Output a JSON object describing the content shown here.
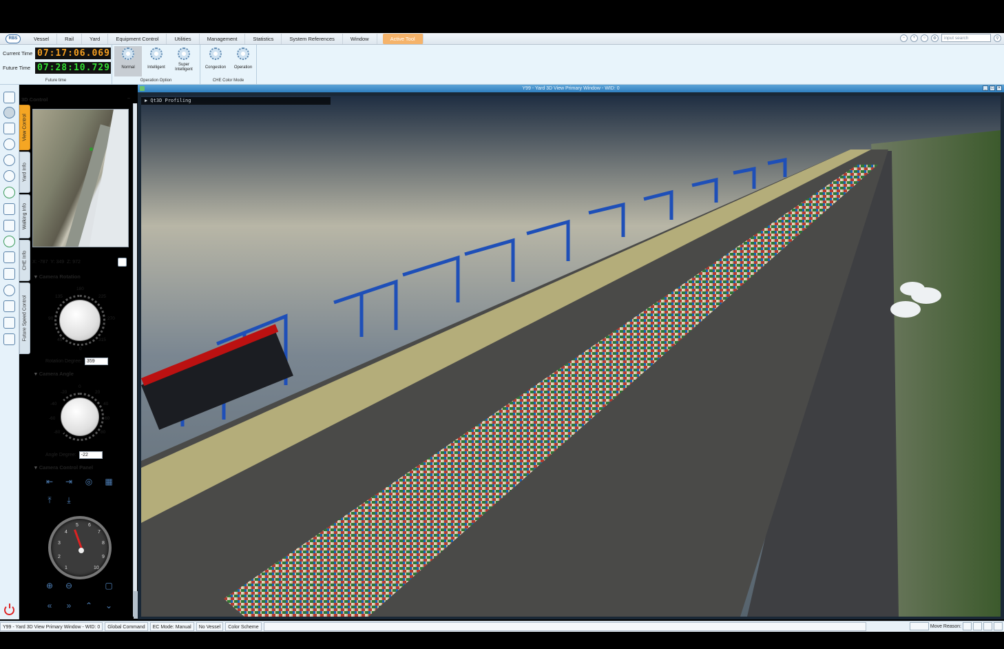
{
  "menubar": {
    "logo": "RBS",
    "items": [
      "Vessel",
      "Rail",
      "Yard",
      "Equipment Control",
      "Utilities",
      "Management",
      "Statistics",
      "System References",
      "Window"
    ],
    "active_tab": "Active Tool",
    "search_placeholder": "input search"
  },
  "ribbon": {
    "current_time_label": "Current Time",
    "current_time_value": "07:17:06.069",
    "future_time_label": "Future Time",
    "future_time_value": "07:28:10.729",
    "future_time_caption": "Future time",
    "operation_option": {
      "caption": "Operation Option",
      "buttons": [
        "Normal",
        "Intelligent",
        "Super Intelligent"
      ],
      "selected": "Normal"
    },
    "che_color_mode": {
      "caption": "CHE Color Mode",
      "buttons": [
        "Congestion",
        "Operation"
      ]
    }
  },
  "side_tabs": [
    "View Control",
    "Yard Info",
    "Walking Info",
    "CHE Info",
    "Future Speed Control"
  ],
  "panel": {
    "title": "3D Control",
    "minimize": "–",
    "coords": {
      "x": "X: -787",
      "y": "Y: 349",
      "z": "Z: 972"
    },
    "camera_rotation": {
      "title": "Camera Rotation",
      "labels": [
        "180",
        "225",
        "270",
        "315",
        "0",
        "45",
        "90",
        "135"
      ],
      "field_label": "Rotation Degree:",
      "value": "359"
    },
    "camera_angle": {
      "title": "Camera Angle",
      "labels": [
        "0",
        "20",
        "40",
        "60",
        "80",
        "-80",
        "-60",
        "-40",
        "-20"
      ],
      "field_label": "Angle Degree:",
      "value": "-22"
    },
    "camera_control_panel": {
      "title": "Camera Control Panel"
    },
    "speed_dial": {
      "numbers": [
        "1",
        "2",
        "3",
        "4",
        "5",
        "6",
        "7",
        "8",
        "9",
        "10"
      ],
      "value": 5
    }
  },
  "view_window": {
    "title": "Y99 - Yard 3D View Primary Window - WID: 0",
    "profiling_label": "▶ Qt3D Profiling"
  },
  "statusbar": {
    "window_label": "Y99 - Yard 3D View Primary Window - WID: 0",
    "items": [
      "Global Command",
      "EC Mode: Manual",
      "No Vessel",
      "Color Scheme"
    ],
    "move_reason": "Move Reason:"
  },
  "colors": {
    "accent": "#f5a623",
    "title_bar": "#2f7fc0",
    "crane_blue": "#1e4fb8",
    "sea": "#6c7f8e",
    "ground": "#3b3c3e"
  }
}
